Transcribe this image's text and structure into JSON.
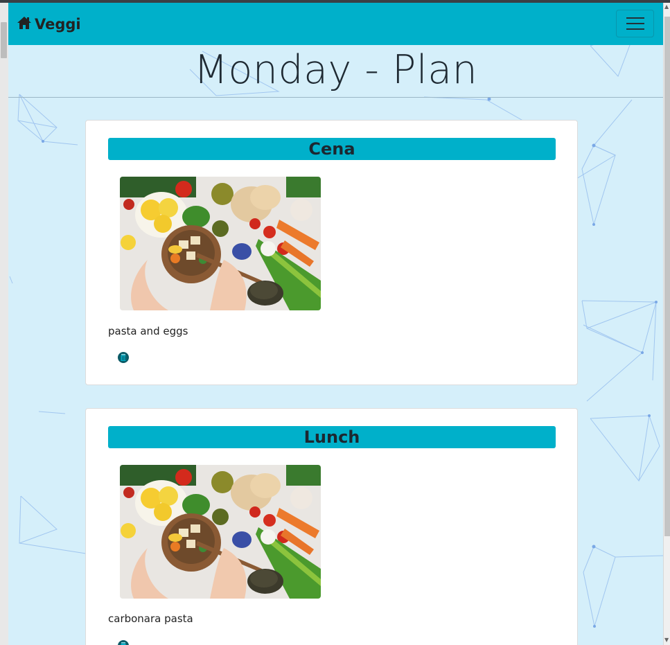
{
  "navbar": {
    "brand_label": "Veggi",
    "brand_icon": "home-icon",
    "toggle_icon": "hamburger-menu-icon"
  },
  "page": {
    "title": "Monday - Plan"
  },
  "meals": [
    {
      "category": "Cena",
      "name": "pasta and eggs",
      "delete_icon": "trash-icon"
    },
    {
      "category": "Lunch",
      "name": "carbonara pasta",
      "delete_icon": "trash-icon"
    }
  ],
  "colors": {
    "accent": "#00b0ca",
    "page_background": "#d5effa",
    "card_background": "#ffffff",
    "text": "#222222"
  }
}
